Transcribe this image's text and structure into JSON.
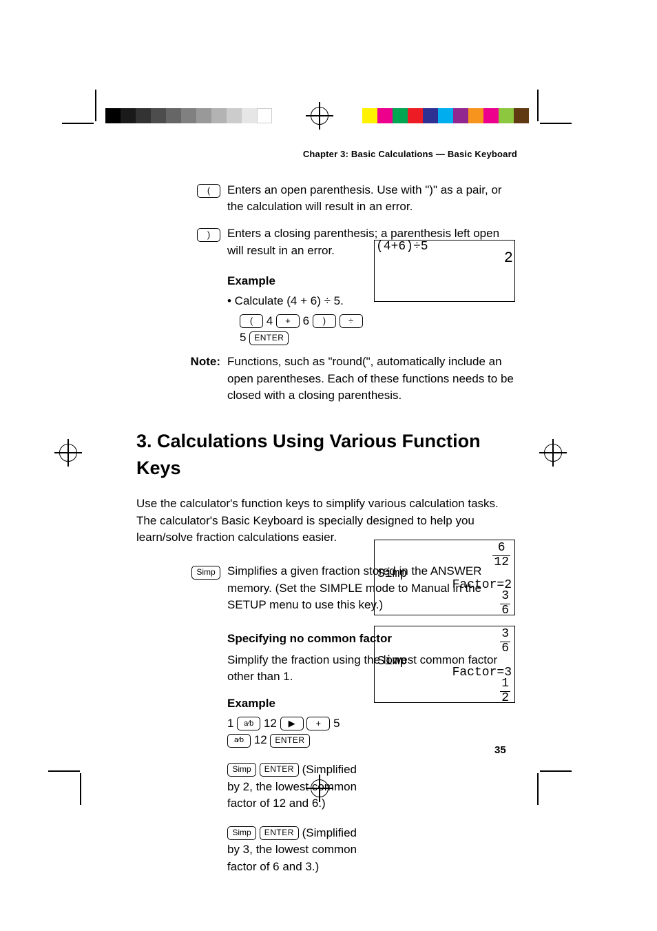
{
  "header": {
    "chapter_line": "Chapter 3: Basic Calculations — Basic Keyboard"
  },
  "keys": {
    "open_paren": "(",
    "close_paren": ")",
    "plus": "+",
    "divide": "÷",
    "enter": "ENTER",
    "simp": "Simp",
    "right_arrow": "▶",
    "frac": "a⁄b"
  },
  "section1": {
    "open_paren_desc": "Enters an open parenthesis. Use with \")\" as a pair, or the calculation will result in an error.",
    "close_paren_desc": "Enters a closing parenthesis; a parenthesis left open will result in an error.",
    "example_label": "Example",
    "example_text": "• Calculate (4 + 6) ÷ 5.",
    "seq_4": "4",
    "seq_6": "6",
    "seq_5": "5",
    "note_label": "Note:",
    "note_text": "Functions, such as \"round(\", automatically include an open parentheses. Each of these functions needs to be closed with a closing parenthesis."
  },
  "section2": {
    "heading": "3. Calculations Using Various Function Keys",
    "intro": "Use the calculator's function keys to simplify various calculation tasks. The calculator's Basic Keyboard is specially designed to help you learn/solve fraction calculations easier.",
    "simp_desc": "Simplifies a given fraction stored in the ANSWER memory. (Set the SIMPLE mode to Manual in the SETUP menu to use this key.)",
    "spec_hdr": "Specifying no common factor",
    "spec_desc": "Simplify the fraction using the lowest common factor other than 1.",
    "example_label": "Example",
    "seq_1": "1",
    "seq_12": "12",
    "seq_5": "5",
    "seq_12b": "12",
    "step2_text1": "(Simplified by 2, the lowest common factor of 12 and 6.)",
    "step3_text": "(Simplified by 3, the lowest common factor of 6 and 3.)"
  },
  "screens": {
    "s1_line1": "(4+6)÷5",
    "s1_result": "2",
    "s2_frac1_num": "6",
    "s2_frac1_den": "12",
    "s2_label": "Simp",
    "s2_factor": "Factor=2",
    "s2_frac2_num": "3",
    "s2_frac2_den": "6",
    "s3_frac1_num": "3",
    "s3_frac1_den": "6",
    "s3_label": "Simp",
    "s3_factor": "Factor=3",
    "s3_frac2_num": "1",
    "s3_frac2_den": "2"
  },
  "page_number": "35",
  "colorbar_left": [
    "#000000",
    "#1a1a1a",
    "#333333",
    "#4d4d4d",
    "#666666",
    "#808080",
    "#999999",
    "#b3b3b3",
    "#cccccc",
    "#e6e6e6",
    "#ffffff"
  ],
  "colorbar_right": [
    "#fff200",
    "#ec008c",
    "#00a651",
    "#ed1c24",
    "#00aeef",
    "#92278f",
    "#f7941d",
    "#ec008c",
    "#00a99d",
    "#2e3192",
    "#8dc63f"
  ]
}
